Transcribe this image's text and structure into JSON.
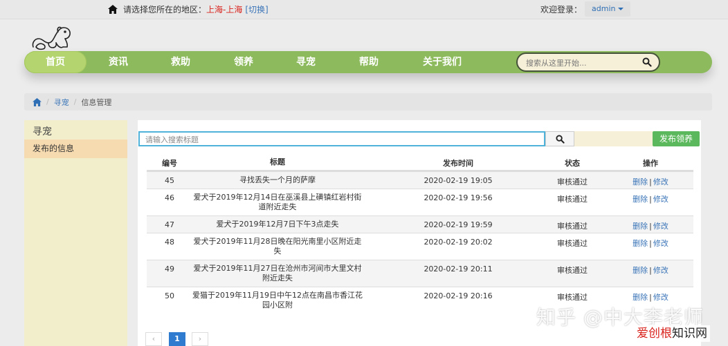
{
  "topbar": {
    "region_prefix": "请选择您所在的地区：",
    "region_city": "上海-上海",
    "region_switch": "[切换]",
    "welcome": "欢迎登录：",
    "username": "admin"
  },
  "nav": {
    "items": [
      "首页",
      "资讯",
      "救助",
      "领养",
      "寻宠",
      "帮助",
      "关于我们"
    ],
    "search_placeholder": "搜索从这里开始..."
  },
  "breadcrumb": {
    "link": "寻宠",
    "current": "信息管理"
  },
  "sidebar": {
    "title": "寻宠",
    "item": "发布的信息"
  },
  "toolbar": {
    "search_placeholder": "请输入搜索标题",
    "publish_label": "发布领养"
  },
  "table": {
    "headers": [
      "编号",
      "标题",
      "发布时间",
      "状态",
      "操作"
    ],
    "rows": [
      {
        "id": "45",
        "title": "寻找丢失一个月的萨摩",
        "time": "2020-02-19 19:05",
        "status": "审核通过"
      },
      {
        "id": "46",
        "title": "爱犬于2019年12月14日在巫溪县上磺镇红岩村街道附近走失",
        "time": "2020-02-19 19:56",
        "status": "审核通过"
      },
      {
        "id": "47",
        "title": "爱犬于2019年12月7日下午3点走失",
        "time": "2020-02-19 19:59",
        "status": "审核通过"
      },
      {
        "id": "48",
        "title": "爱犬于2019年11月28日晚在阳光南里小区附近走失",
        "time": "2020-02-19 20:02",
        "status": "审核通过"
      },
      {
        "id": "49",
        "title": "爱犬于2019年11月27日在沧州市河间市大里文村附近走失",
        "time": "2020-02-19 20:11",
        "status": "审核通过"
      },
      {
        "id": "50",
        "title": "爱猫于2019年11月19日中午12点在南昌市香江花园小区附",
        "time": "2020-02-19 20:16",
        "status": "审核通过"
      }
    ],
    "delete_label": "删除",
    "edit_label": "修改",
    "op_sep": "|"
  },
  "pagination": {
    "prev": "‹",
    "current": "1",
    "next": "›"
  },
  "watermark": {
    "line1": "知乎 @中大李老师",
    "part_a": "爱创根",
    "part_b": "知识网"
  },
  "colors": {
    "nav_bg": "#8dba5c",
    "nav_active": "#b3d46e",
    "publish_button": "#5cb85c",
    "link": "#3b75b8",
    "city": "#d9231d"
  }
}
